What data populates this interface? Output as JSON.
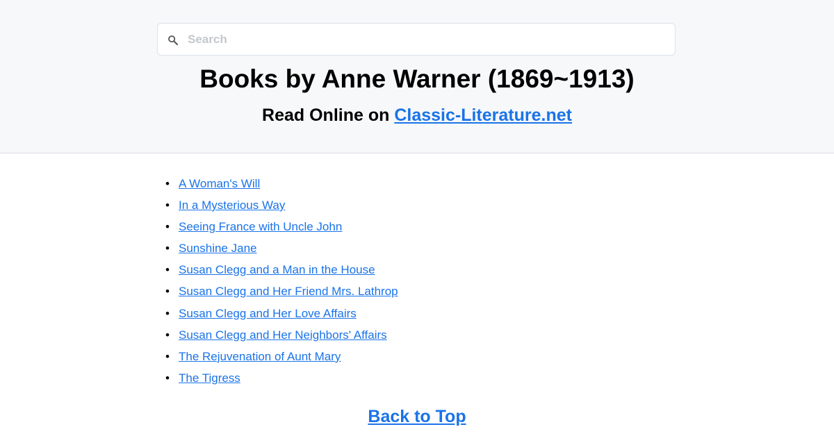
{
  "search": {
    "placeholder": "Search",
    "icon": "search-icon"
  },
  "header": {
    "title": "Books by Anne Warner (1869~1913)",
    "subtitle_prefix": "Read Online on ",
    "subtitle_link": "Classic-Literature.net"
  },
  "books": [
    "A Woman's Will",
    "In a Mysterious Way",
    "Seeing France with Uncle John",
    "Sunshine Jane",
    "Susan Clegg and a Man in the House",
    "Susan Clegg and Her Friend Mrs. Lathrop",
    "Susan Clegg and Her Love Affairs",
    "Susan Clegg and Her Neighbors' Affairs",
    "The Rejuvenation of Aunt Mary",
    "The Tigress"
  ],
  "footer": {
    "back_to_top": "Back to Top"
  },
  "colors": {
    "link": "#1a73e8",
    "header_bg": "#f7f8fa"
  }
}
